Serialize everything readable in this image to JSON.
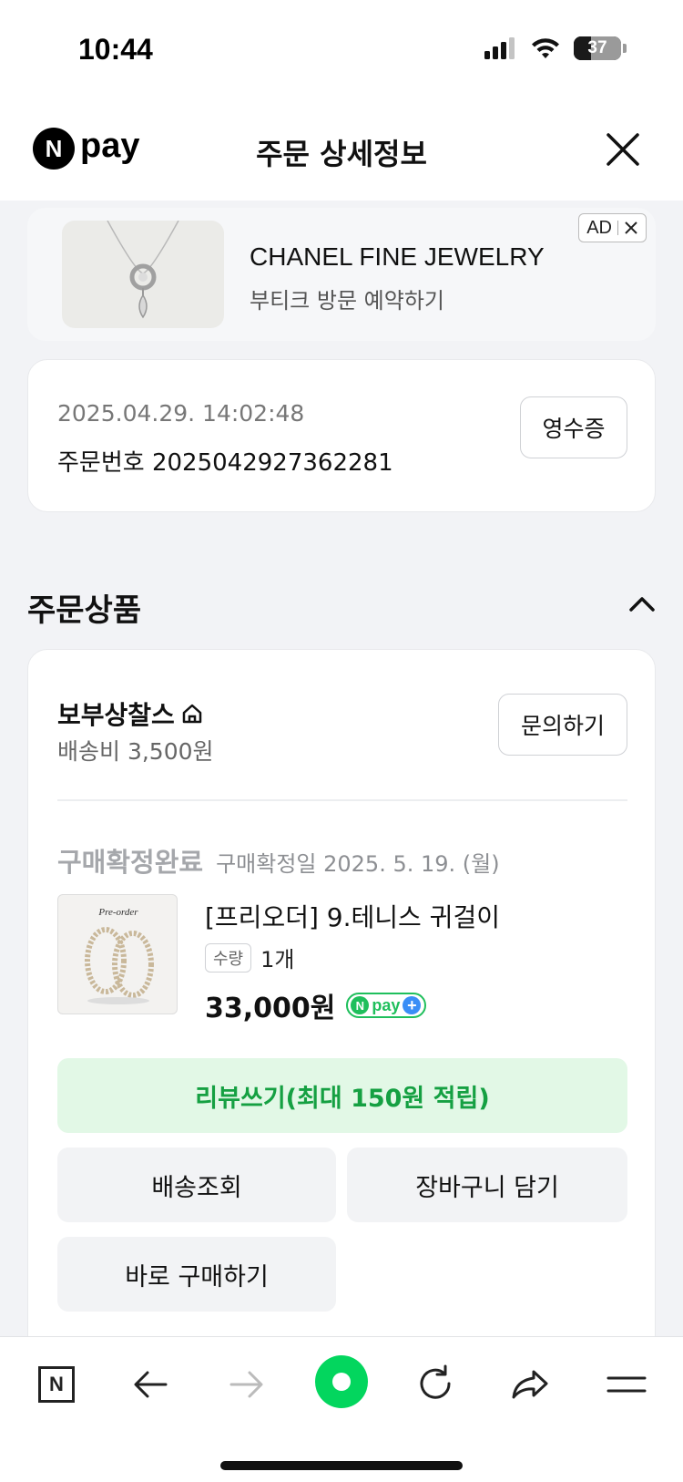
{
  "status_bar": {
    "time": "10:44",
    "battery": "37",
    "battery_level": 0.37
  },
  "header": {
    "logo_letter": "N",
    "logo_text": "pay",
    "title": "주문 상세정보"
  },
  "ad": {
    "title": "CHANEL FINE JEWELRY",
    "subtitle": "부티크 방문 예약하기",
    "badge": "AD"
  },
  "order": {
    "datetime": "2025.04.29. 14:02:48",
    "number": "주문번호 2025042927362281",
    "receipt_label": "영수증"
  },
  "section": {
    "title": "주문상품"
  },
  "seller": {
    "name": "보부상찰스",
    "shipping": "배송비 3,500원",
    "inquiry_label": "문의하기"
  },
  "item": {
    "status": "구매확정완료",
    "status_date": "구매확정일 2025. 5. 19. (월)",
    "thumb_caption": "Pre-order",
    "name": "[프리오더] 9.테니스 귀걸이",
    "qty_label": "수량",
    "qty": "1개",
    "price": "33,000원",
    "badge": {
      "n": "N",
      "text": "pay",
      "plus": "+"
    }
  },
  "actions": {
    "review": "리뷰쓰기(최대 150원 적립)",
    "shipping_track": "배송조회",
    "add_cart": "장바구니 담기",
    "buy_now": "바로 구매하기"
  },
  "bottom_nav": {
    "home_letter": "N"
  },
  "colors": {
    "accent_green": "#15a042",
    "review_bg": "#e2f8e6",
    "npay_green": "#1fbf5c",
    "npay_blue": "#3a8ef6",
    "browser_green": "#03d65e"
  }
}
